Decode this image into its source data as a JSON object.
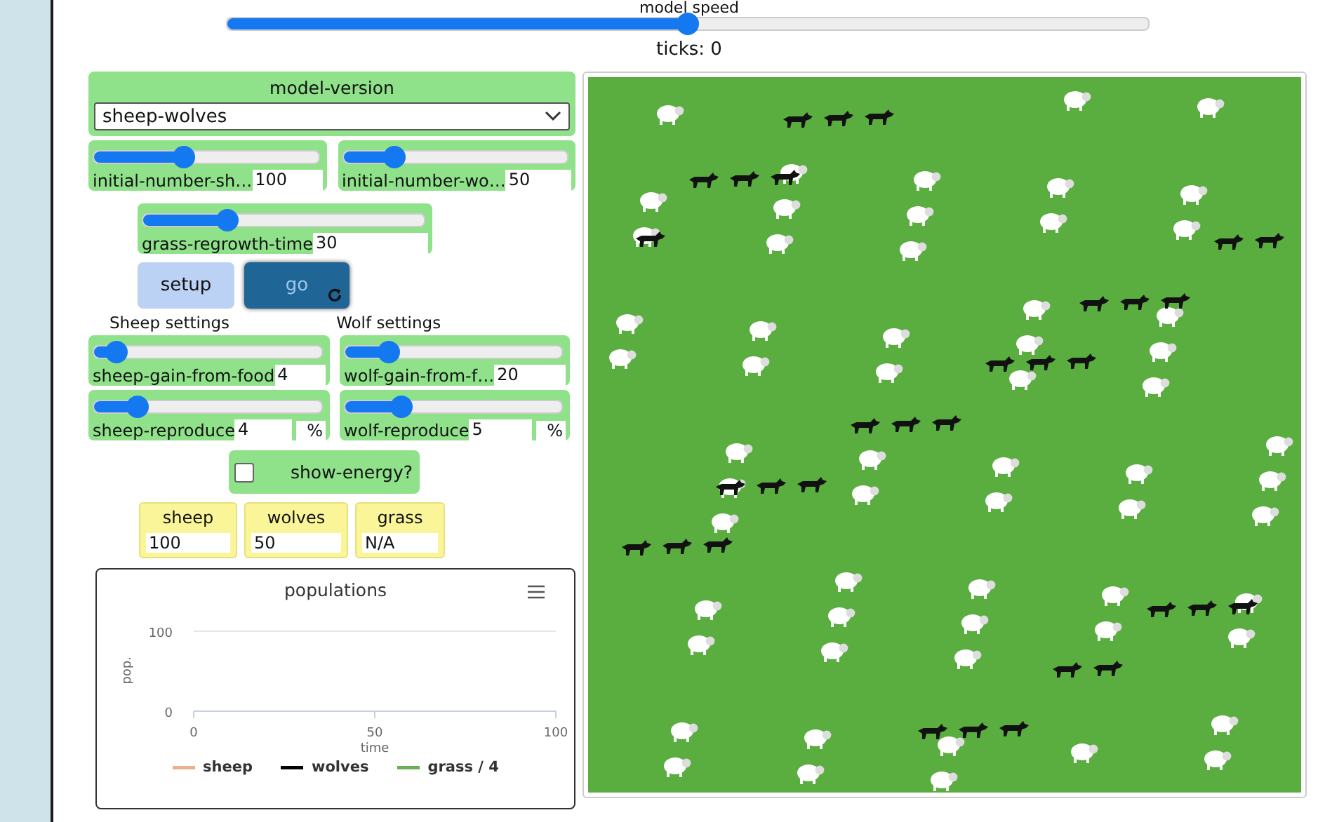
{
  "speed": {
    "label": "model speed",
    "level": 0.5
  },
  "ticks": "ticks: 0",
  "chooser": {
    "label": "model-version",
    "value": "sheep-wolves"
  },
  "sliders_top": [
    {
      "label": "initial-number-sh…",
      "value": "100",
      "level": 0.4
    },
    {
      "label": "initial-number-wo…",
      "value": "50",
      "level": 0.23
    }
  ],
  "grass_slider": {
    "label": "grass-regrowth-time",
    "value": "30",
    "level": 0.3
  },
  "buttons": [
    {
      "label": "setup",
      "kind": "once"
    },
    {
      "label": "go",
      "kind": "forever"
    }
  ],
  "section_labels": [
    "Sheep settings",
    "Wolf settings"
  ],
  "settings_sliders": [
    {
      "label": "sheep-gain-from-food",
      "value": "4",
      "level": 0.1
    },
    {
      "label": "wolf-gain-from-f…",
      "value": "20",
      "level": 0.2
    },
    {
      "label": "sheep-reproduce",
      "value": "4",
      "unit": "%",
      "level": 0.19
    },
    {
      "label": "wolf-reproduce",
      "value": "5",
      "unit": "%",
      "level": 0.26
    }
  ],
  "switch": {
    "label": "show-energy?",
    "checked": false
  },
  "monitors": [
    {
      "label": "sheep",
      "value": "100"
    },
    {
      "label": "wolves",
      "value": "50"
    },
    {
      "label": "grass",
      "value": "N/A"
    }
  ],
  "plot": {
    "title": "populations",
    "y_axis_title": "pop.",
    "x_axis_title": "time",
    "y_tick_labels": [
      "100",
      "0"
    ],
    "x_tick_labels": [
      "0",
      "50",
      "100"
    ],
    "legend": [
      {
        "name": "sheep",
        "color": "#e8b08c"
      },
      {
        "name": "wolves",
        "color": "#000000"
      },
      {
        "name": "grass / 4",
        "color": "#6aae5a"
      }
    ]
  }
}
